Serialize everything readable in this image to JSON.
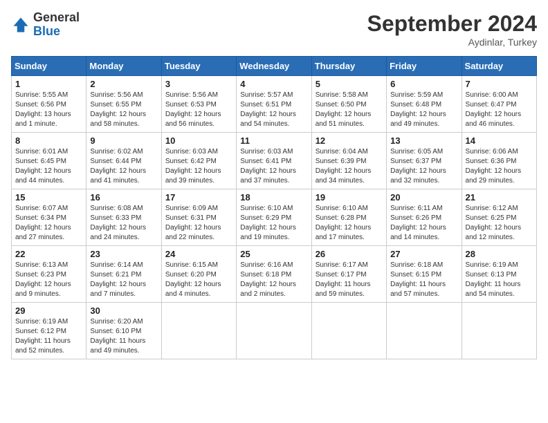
{
  "header": {
    "logo_general": "General",
    "logo_blue": "Blue",
    "month_title": "September 2024",
    "subtitle": "Aydinlar, Turkey"
  },
  "days_of_week": [
    "Sunday",
    "Monday",
    "Tuesday",
    "Wednesday",
    "Thursday",
    "Friday",
    "Saturday"
  ],
  "weeks": [
    [
      {
        "day": "1",
        "info": "Sunrise: 5:55 AM\nSunset: 6:56 PM\nDaylight: 13 hours\nand 1 minute."
      },
      {
        "day": "2",
        "info": "Sunrise: 5:56 AM\nSunset: 6:55 PM\nDaylight: 12 hours\nand 58 minutes."
      },
      {
        "day": "3",
        "info": "Sunrise: 5:56 AM\nSunset: 6:53 PM\nDaylight: 12 hours\nand 56 minutes."
      },
      {
        "day": "4",
        "info": "Sunrise: 5:57 AM\nSunset: 6:51 PM\nDaylight: 12 hours\nand 54 minutes."
      },
      {
        "day": "5",
        "info": "Sunrise: 5:58 AM\nSunset: 6:50 PM\nDaylight: 12 hours\nand 51 minutes."
      },
      {
        "day": "6",
        "info": "Sunrise: 5:59 AM\nSunset: 6:48 PM\nDaylight: 12 hours\nand 49 minutes."
      },
      {
        "day": "7",
        "info": "Sunrise: 6:00 AM\nSunset: 6:47 PM\nDaylight: 12 hours\nand 46 minutes."
      }
    ],
    [
      {
        "day": "8",
        "info": "Sunrise: 6:01 AM\nSunset: 6:45 PM\nDaylight: 12 hours\nand 44 minutes."
      },
      {
        "day": "9",
        "info": "Sunrise: 6:02 AM\nSunset: 6:44 PM\nDaylight: 12 hours\nand 41 minutes."
      },
      {
        "day": "10",
        "info": "Sunrise: 6:03 AM\nSunset: 6:42 PM\nDaylight: 12 hours\nand 39 minutes."
      },
      {
        "day": "11",
        "info": "Sunrise: 6:03 AM\nSunset: 6:41 PM\nDaylight: 12 hours\nand 37 minutes."
      },
      {
        "day": "12",
        "info": "Sunrise: 6:04 AM\nSunset: 6:39 PM\nDaylight: 12 hours\nand 34 minutes."
      },
      {
        "day": "13",
        "info": "Sunrise: 6:05 AM\nSunset: 6:37 PM\nDaylight: 12 hours\nand 32 minutes."
      },
      {
        "day": "14",
        "info": "Sunrise: 6:06 AM\nSunset: 6:36 PM\nDaylight: 12 hours\nand 29 minutes."
      }
    ],
    [
      {
        "day": "15",
        "info": "Sunrise: 6:07 AM\nSunset: 6:34 PM\nDaylight: 12 hours\nand 27 minutes."
      },
      {
        "day": "16",
        "info": "Sunrise: 6:08 AM\nSunset: 6:33 PM\nDaylight: 12 hours\nand 24 minutes."
      },
      {
        "day": "17",
        "info": "Sunrise: 6:09 AM\nSunset: 6:31 PM\nDaylight: 12 hours\nand 22 minutes."
      },
      {
        "day": "18",
        "info": "Sunrise: 6:10 AM\nSunset: 6:29 PM\nDaylight: 12 hours\nand 19 minutes."
      },
      {
        "day": "19",
        "info": "Sunrise: 6:10 AM\nSunset: 6:28 PM\nDaylight: 12 hours\nand 17 minutes."
      },
      {
        "day": "20",
        "info": "Sunrise: 6:11 AM\nSunset: 6:26 PM\nDaylight: 12 hours\nand 14 minutes."
      },
      {
        "day": "21",
        "info": "Sunrise: 6:12 AM\nSunset: 6:25 PM\nDaylight: 12 hours\nand 12 minutes."
      }
    ],
    [
      {
        "day": "22",
        "info": "Sunrise: 6:13 AM\nSunset: 6:23 PM\nDaylight: 12 hours\nand 9 minutes."
      },
      {
        "day": "23",
        "info": "Sunrise: 6:14 AM\nSunset: 6:21 PM\nDaylight: 12 hours\nand 7 minutes."
      },
      {
        "day": "24",
        "info": "Sunrise: 6:15 AM\nSunset: 6:20 PM\nDaylight: 12 hours\nand 4 minutes."
      },
      {
        "day": "25",
        "info": "Sunrise: 6:16 AM\nSunset: 6:18 PM\nDaylight: 12 hours\nand 2 minutes."
      },
      {
        "day": "26",
        "info": "Sunrise: 6:17 AM\nSunset: 6:17 PM\nDaylight: 11 hours\nand 59 minutes."
      },
      {
        "day": "27",
        "info": "Sunrise: 6:18 AM\nSunset: 6:15 PM\nDaylight: 11 hours\nand 57 minutes."
      },
      {
        "day": "28",
        "info": "Sunrise: 6:19 AM\nSunset: 6:13 PM\nDaylight: 11 hours\nand 54 minutes."
      }
    ],
    [
      {
        "day": "29",
        "info": "Sunrise: 6:19 AM\nSunset: 6:12 PM\nDaylight: 11 hours\nand 52 minutes."
      },
      {
        "day": "30",
        "info": "Sunrise: 6:20 AM\nSunset: 6:10 PM\nDaylight: 11 hours\nand 49 minutes."
      },
      {
        "day": "",
        "info": ""
      },
      {
        "day": "",
        "info": ""
      },
      {
        "day": "",
        "info": ""
      },
      {
        "day": "",
        "info": ""
      },
      {
        "day": "",
        "info": ""
      }
    ]
  ]
}
